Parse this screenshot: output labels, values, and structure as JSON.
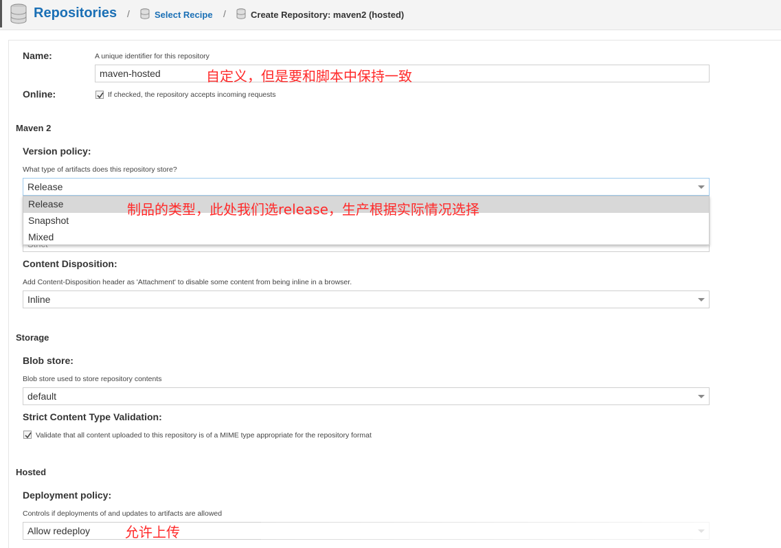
{
  "header": {
    "title": "Repositories",
    "separator": "/",
    "crumb_select_recipe": "Select Recipe",
    "crumb_current": "Create Repository: maven2 (hosted)"
  },
  "name": {
    "label": "Name:",
    "help": "A unique identifier for this repository",
    "value": "maven-hosted"
  },
  "online": {
    "label": "Online:",
    "checked": true,
    "help": "If checked, the repository accepts incoming requests"
  },
  "maven2": {
    "section_title": "Maven 2",
    "version_policy": {
      "label": "Version policy:",
      "help": "What type of artifacts does this repository store?",
      "value": "Release",
      "options": [
        "Release",
        "Snapshot",
        "Mixed"
      ],
      "hidden_value_fragment": "Strict"
    },
    "content_disposition": {
      "label": "Content Disposition:",
      "help": "Add Content-Disposition header as 'Attachment' to disable some content from being inline in a browser.",
      "value": "Inline"
    }
  },
  "storage": {
    "section_title": "Storage",
    "blob_store": {
      "label": "Blob store:",
      "help": "Blob store used to store repository contents",
      "value": "default"
    },
    "strict_validation": {
      "label": "Strict Content Type Validation:",
      "checked": true,
      "help": "Validate that all content uploaded to this repository is of a MIME type appropriate for the repository format"
    }
  },
  "hosted": {
    "section_title": "Hosted",
    "deployment_policy": {
      "label": "Deployment policy:",
      "help": "Controls if deployments of and updates to artifacts are allowed",
      "value": "Allow redeploy"
    }
  },
  "annotations": {
    "name_note": "自定义，但是要和脚本中保持一致",
    "version_note": "制品的类型，此处我们选release，生产根据实际情况选择",
    "deploy_note": "允许上传"
  },
  "colors": {
    "link_blue": "#1a6fb5",
    "annotation_red": "#ff2a2a",
    "selected_option_bg": "#d8d8d8"
  }
}
